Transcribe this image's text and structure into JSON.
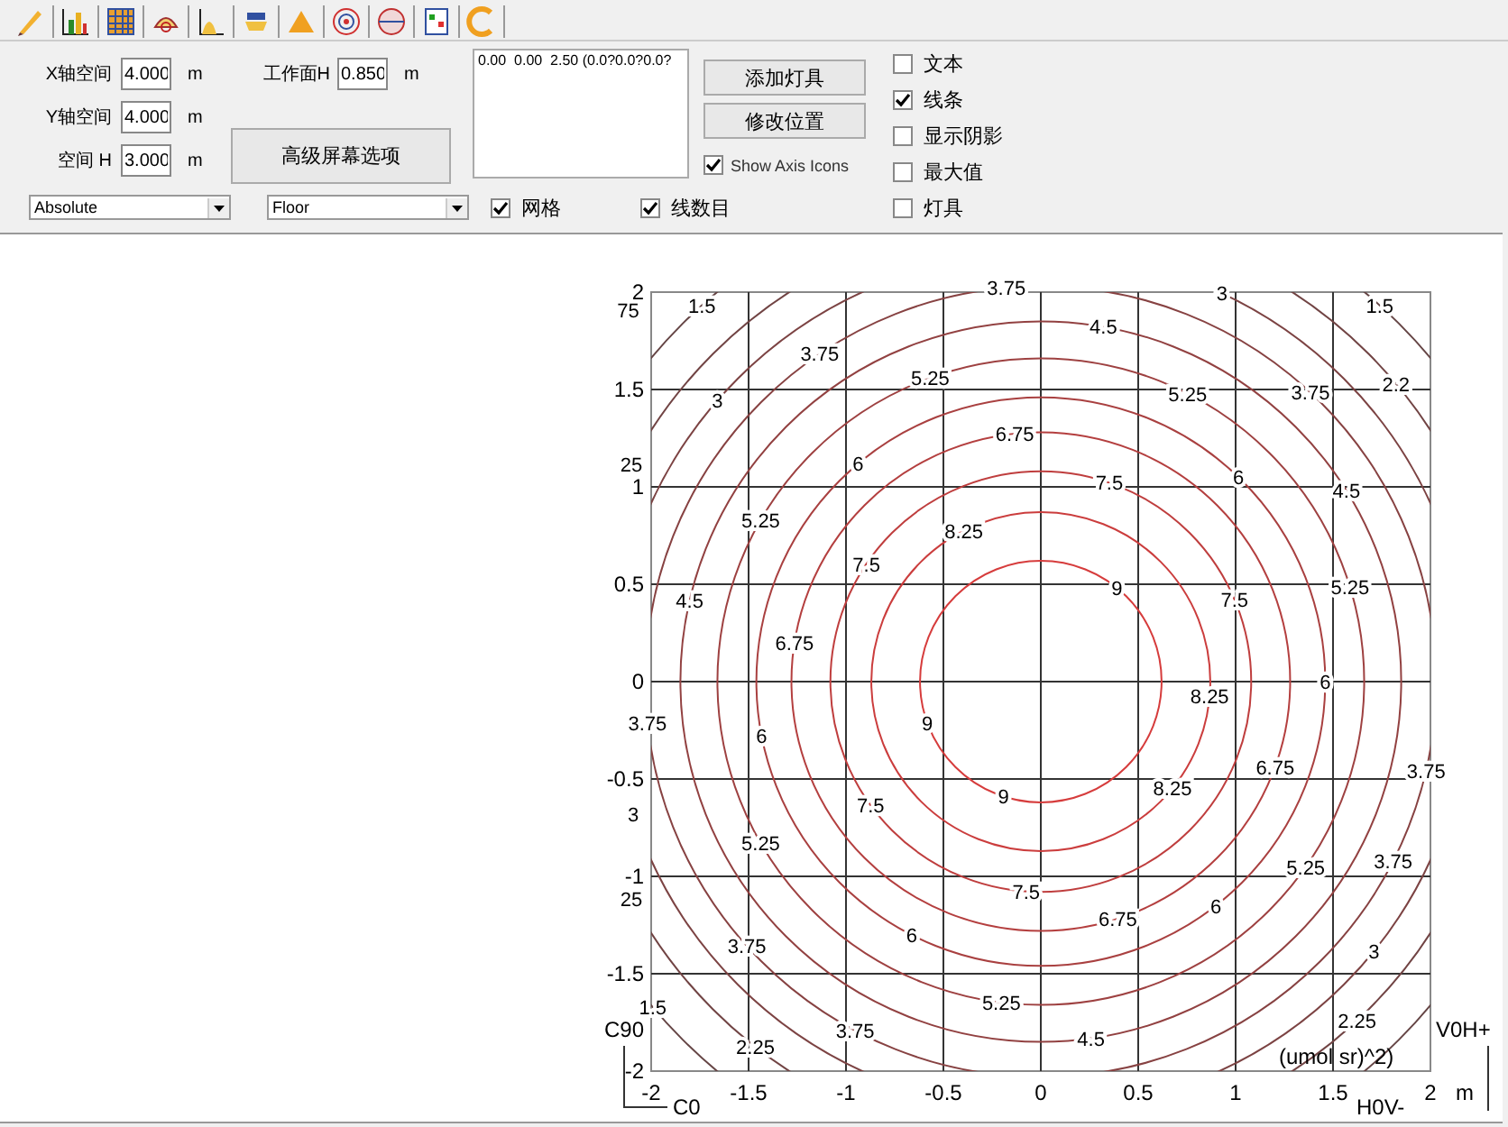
{
  "fields": [
    {
      "label": "X轴空间",
      "value": "4.000",
      "unit": "m"
    },
    {
      "label": "Y轴空间",
      "value": "4.000",
      "unit": "m"
    },
    {
      "label": "空间 H",
      "value": "3.000",
      "unit": "m"
    }
  ],
  "workplane": {
    "label": "工作面H",
    "value": "0.850",
    "unit": "m"
  },
  "advanced_button": "高级屏幕选项",
  "luminaire_list": [
    "0.00  0.00  2.50 (0.0?0.0?0.0?"
  ],
  "buttons": [
    "添加灯具",
    "修改位置"
  ],
  "show_axis_icons": {
    "label": "Show Axis Icons",
    "checked": true
  },
  "options": [
    {
      "label": "文本",
      "checked": false
    },
    {
      "label": "线条",
      "checked": true
    },
    {
      "label": "显示阴影",
      "checked": false
    },
    {
      "label": "最大值",
      "checked": false
    }
  ],
  "selects": [
    {
      "value": "Absolute"
    },
    {
      "value": "Floor"
    }
  ],
  "row_options": [
    {
      "label": "网格",
      "checked": true
    },
    {
      "label": "线数目",
      "checked": true
    },
    {
      "label": "灯具",
      "checked": false
    }
  ],
  "plot": {
    "x_ticks": [
      "-2",
      "-1.5",
      "-1",
      "-0.5",
      "0",
      "0.5",
      "1",
      "1.5",
      "2"
    ],
    "y_ticks": [
      "2",
      "1.5",
      "1",
      "0.5",
      "0",
      "-0.5",
      "-1",
      "-1.5",
      "-2"
    ],
    "x_unit": "m",
    "value_unit": "(umol sr)^2)",
    "axis_icons": {
      "left_top": "C90",
      "left_bottom": "C0",
      "right_top": "V0H+",
      "right_bottom": "H0V-"
    },
    "contours": [
      {
        "labels": [
          "75"
        ]
      },
      {
        "labels": [
          "1.5",
          "1.5",
          "1.5"
        ]
      },
      {
        "labels": [
          "2.25",
          "2.25",
          "25",
          "25",
          "2.2"
        ]
      },
      {
        "labels": [
          "3",
          "3",
          "3",
          "3"
        ]
      },
      {
        "labels": [
          "3.75",
          "3.75",
          "3.75",
          "3.75",
          "3.75",
          "3.75",
          "3.75",
          "3.75"
        ]
      },
      {
        "labels": [
          "4.5",
          "4.5",
          "4.5",
          "4.5"
        ]
      },
      {
        "labels": [
          "5.25",
          "5.25",
          "5.25",
          "5.25",
          "5.25",
          "5.25",
          "5.25"
        ]
      },
      {
        "labels": [
          "6",
          "6",
          "6",
          "6",
          "6",
          "6"
        ]
      },
      {
        "labels": [
          "6.75",
          "6.75",
          "6.75",
          "6.75"
        ]
      },
      {
        "labels": [
          "7.5",
          "7.5",
          "7.5",
          "7.5",
          "7.5"
        ]
      },
      {
        "labels": [
          "8.25",
          "8.25",
          "8.25"
        ]
      },
      {
        "labels": [
          "9",
          "9",
          "9"
        ]
      }
    ]
  }
}
